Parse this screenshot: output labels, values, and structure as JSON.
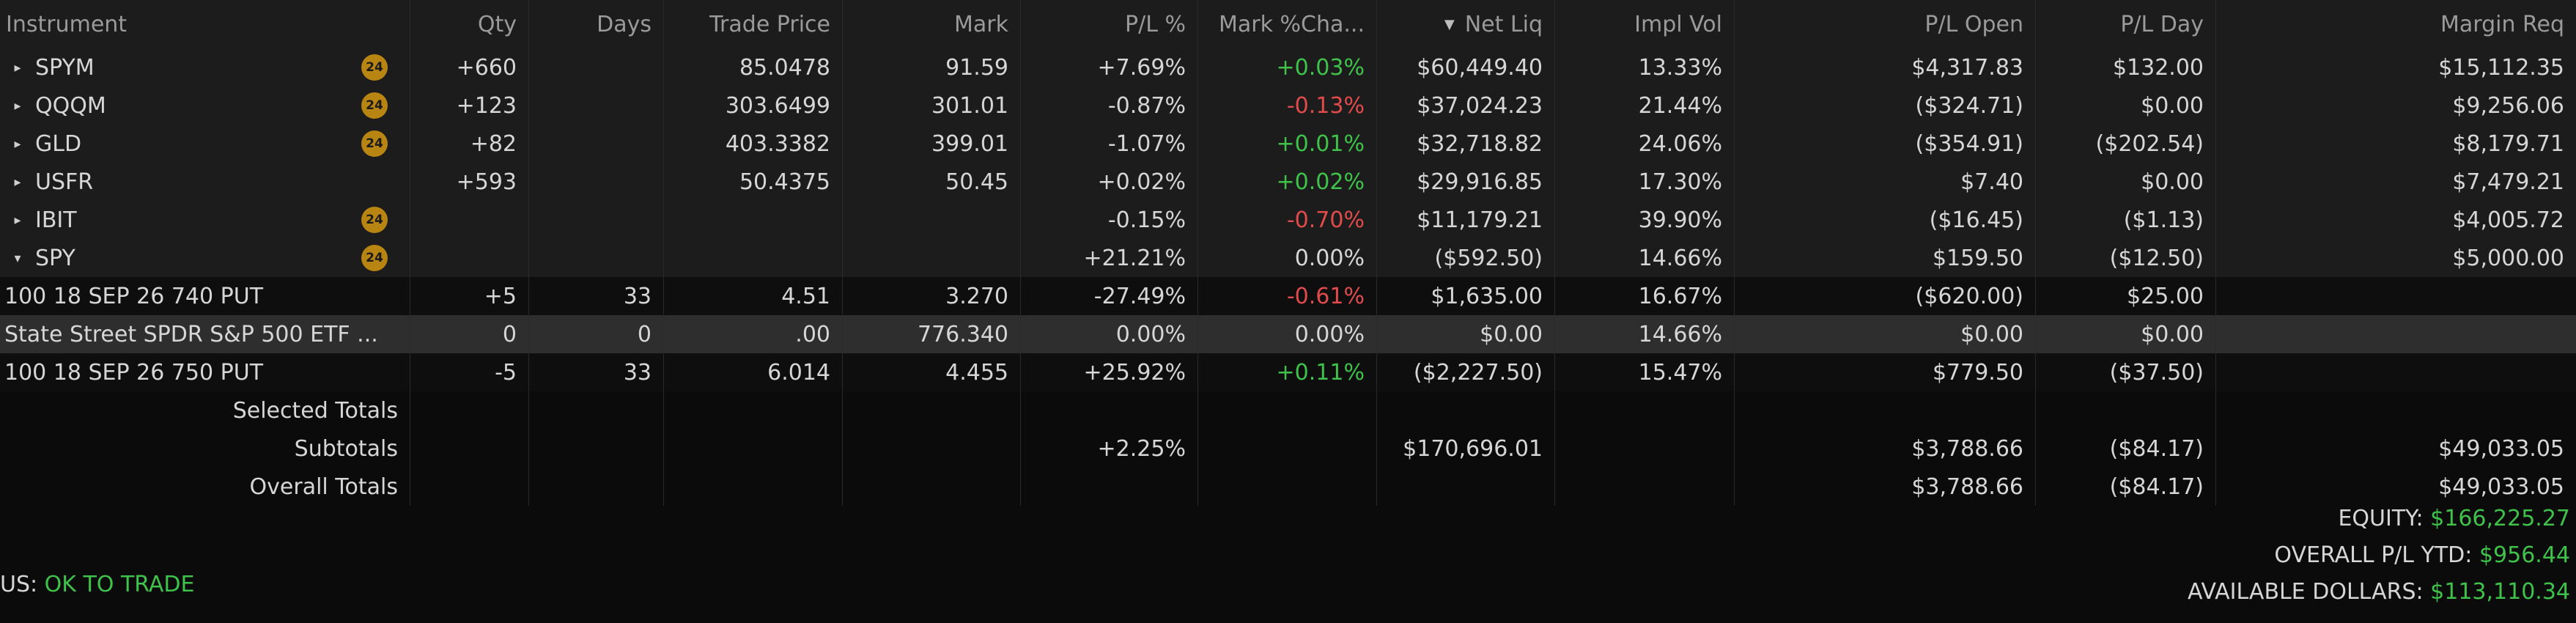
{
  "columns": [
    "Instrument",
    "Qty",
    "Days",
    "Trade Price",
    "Mark",
    "P/L %",
    "Mark %Cha...",
    "Net Liq",
    "Impl Vol",
    "P/L Open",
    "P/L Day",
    "Margin Req"
  ],
  "positions": [
    {
      "symbol": "SPYM",
      "badge": "24",
      "expanded": false,
      "qty": "+660",
      "days": "",
      "trade_price": "85.0478",
      "mark": "91.59",
      "pl_pct": "+7.69%",
      "mark_chg": "+0.03%",
      "mark_chg_color": "green",
      "net_liq": "$60,449.40",
      "impl_vol": "13.33%",
      "pl_open": "$4,317.83",
      "pl_day": "$132.00",
      "margin_req": "$15,112.35"
    },
    {
      "symbol": "QQQM",
      "badge": "24",
      "expanded": false,
      "qty": "+123",
      "days": "",
      "trade_price": "303.6499",
      "mark": "301.01",
      "pl_pct": "-0.87%",
      "mark_chg": "-0.13%",
      "mark_chg_color": "red",
      "net_liq": "$37,024.23",
      "impl_vol": "21.44%",
      "pl_open": "($324.71)",
      "pl_day": "$0.00",
      "margin_req": "$9,256.06"
    },
    {
      "symbol": "GLD",
      "badge": "24",
      "expanded": false,
      "qty": "+82",
      "days": "",
      "trade_price": "403.3382",
      "mark": "399.01",
      "pl_pct": "-1.07%",
      "mark_chg": "+0.01%",
      "mark_chg_color": "green",
      "net_liq": "$32,718.82",
      "impl_vol": "24.06%",
      "pl_open": "($354.91)",
      "pl_day": "($202.54)",
      "margin_req": "$8,179.71"
    },
    {
      "symbol": "USFR",
      "badge": "",
      "expanded": false,
      "qty": "+593",
      "days": "",
      "trade_price": "50.4375",
      "mark": "50.45",
      "pl_pct": "+0.02%",
      "mark_chg": "+0.02%",
      "mark_chg_color": "green",
      "net_liq": "$29,916.85",
      "impl_vol": "17.30%",
      "pl_open": "$7.40",
      "pl_day": "$0.00",
      "margin_req": "$7,479.21"
    },
    {
      "symbol": "IBIT",
      "badge": "24",
      "expanded": false,
      "qty": "",
      "days": "",
      "trade_price": "",
      "mark": "",
      "pl_pct": "-0.15%",
      "mark_chg": "-0.70%",
      "mark_chg_color": "red",
      "net_liq": "$11,179.21",
      "impl_vol": "39.90%",
      "pl_open": "($16.45)",
      "pl_day": "($1.13)",
      "margin_req": "$4,005.72"
    },
    {
      "symbol": "SPY",
      "badge": "24",
      "expanded": true,
      "qty": "",
      "days": "",
      "trade_price": "",
      "mark": "",
      "pl_pct": "+21.21%",
      "mark_chg": "0.00%",
      "mark_chg_color": "neutral",
      "net_liq": "($592.50)",
      "impl_vol": "14.66%",
      "pl_open": "$159.50",
      "pl_day": "($12.50)",
      "margin_req": "$5,000.00"
    }
  ],
  "legs": [
    {
      "name": "100 18 SEP 26 740 PUT",
      "selected": false,
      "qty": "+5",
      "days": "33",
      "trade_price": "4.51",
      "mark": "3.270",
      "pl_pct": "-27.49%",
      "mark_chg": "-0.61%",
      "mark_chg_color": "red",
      "net_liq": "$1,635.00",
      "impl_vol": "16.67%",
      "pl_open": "($620.00)",
      "pl_day": "$25.00",
      "margin_req": ""
    },
    {
      "name": "State Street SPDR S&P 500 ETF ...",
      "selected": true,
      "qty": "0",
      "days": "0",
      "trade_price": ".00",
      "mark": "776.340",
      "pl_pct": "0.00%",
      "mark_chg": "0.00%",
      "mark_chg_color": "neutral",
      "net_liq": "$0.00",
      "impl_vol": "14.66%",
      "pl_open": "$0.00",
      "pl_day": "$0.00",
      "margin_req": ""
    },
    {
      "name": "100 18 SEP 26 750 PUT",
      "selected": false,
      "qty": "-5",
      "days": "33",
      "trade_price": "6.014",
      "mark": "4.455",
      "pl_pct": "+25.92%",
      "mark_chg": "+0.11%",
      "mark_chg_color": "green",
      "net_liq": "($2,227.50)",
      "impl_vol": "15.47%",
      "pl_open": "$779.50",
      "pl_day": "($37.50)",
      "margin_req": ""
    }
  ],
  "totals": [
    {
      "label": "Selected Totals",
      "pl_pct": "",
      "net_liq": "",
      "pl_open": "",
      "pl_day": "",
      "margin_req": ""
    },
    {
      "label": "Subtotals",
      "pl_pct": "+2.25%",
      "net_liq": "$170,696.01",
      "pl_open": "$3,788.66",
      "pl_day": "($84.17)",
      "margin_req": "$49,033.05"
    },
    {
      "label": "Overall Totals",
      "pl_pct": "",
      "net_liq": "",
      "pl_open": "$3,788.66",
      "pl_day": "($84.17)",
      "margin_req": "$49,033.05"
    }
  ],
  "summary": {
    "equity_label": "EQUITY:",
    "equity_value": "$166,225.27",
    "pl_ytd_label": "OVERALL P/L YTD:",
    "pl_ytd_value": "$956.44",
    "available_label": "AVAILABLE DOLLARS:",
    "available_value": "$113,110.34"
  },
  "status": {
    "label": "US:",
    "value": "OK TO TRADE"
  },
  "colors": {
    "green": "#3ec24a",
    "red": "#e24b4b",
    "badge": "#b88412"
  },
  "icons": {
    "collapsed": "expand-triangle-icon",
    "expanded": "collapse-triangle-icon",
    "sort": "sort-descending-icon"
  }
}
